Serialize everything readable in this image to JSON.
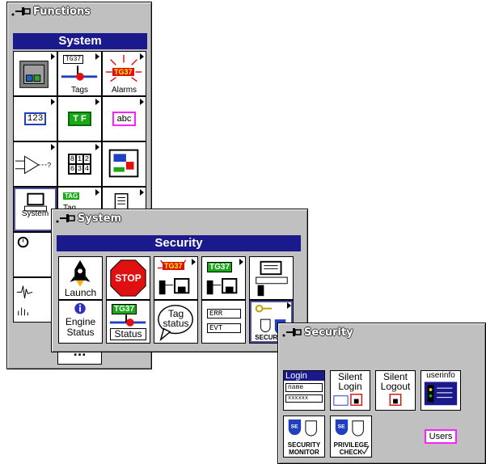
{
  "functions_palette": {
    "title": "Functions",
    "section": "System",
    "tiles": {
      "tag_label": "TG37",
      "tags_label": "Tags",
      "alarm_tag": "TG37",
      "alarms_label": "Alarms",
      "numeric": "123",
      "boolean": "T F",
      "string": "abc",
      "array_cells": [
        "8",
        "1",
        "2",
        "6",
        "3",
        "4"
      ],
      "system_label": "System",
      "tag_green": "TAG",
      "tag_partial": "Tag",
      "more": "..."
    }
  },
  "system_palette": {
    "title": "System",
    "section": "Security",
    "tiles": {
      "launch_label": "Launch",
      "stop_label": "STOP",
      "alarm_tag": "TG37",
      "green_tag": "TG37",
      "engine_status_line1": "Engine",
      "engine_status_line2": "Status",
      "status_tag": "TG37",
      "status_label": "Status",
      "tag_status_line1": "Tag",
      "tag_status_line2": "status",
      "err_label": "ERR",
      "evt_label": "EVT",
      "security_label": "SECURITY"
    }
  },
  "security_palette": {
    "title": "Security",
    "tiles": {
      "login_title": "Login",
      "login_name": "name",
      "login_pass": "xxxxxx",
      "silent_login_line1": "Silent",
      "silent_login_line2": "Login",
      "silent_logout_line1": "Silent",
      "silent_logout_line2": "Logout",
      "userinfo": "userinfo",
      "security_monitor_line1": "SECURITY",
      "security_monitor_line2": "MONITOR",
      "privilege_check_line1": "PRIVILEGE",
      "privilege_check_line2": "CHECK",
      "users": "Users",
      "se_badge": "SE"
    }
  },
  "colors": {
    "palette_bg": "#c0c0c0",
    "section_bar": "#1a1a8c",
    "tag_green": "#18a818",
    "alarm_red": "#e01010",
    "string_pink": "#ff20ff"
  }
}
